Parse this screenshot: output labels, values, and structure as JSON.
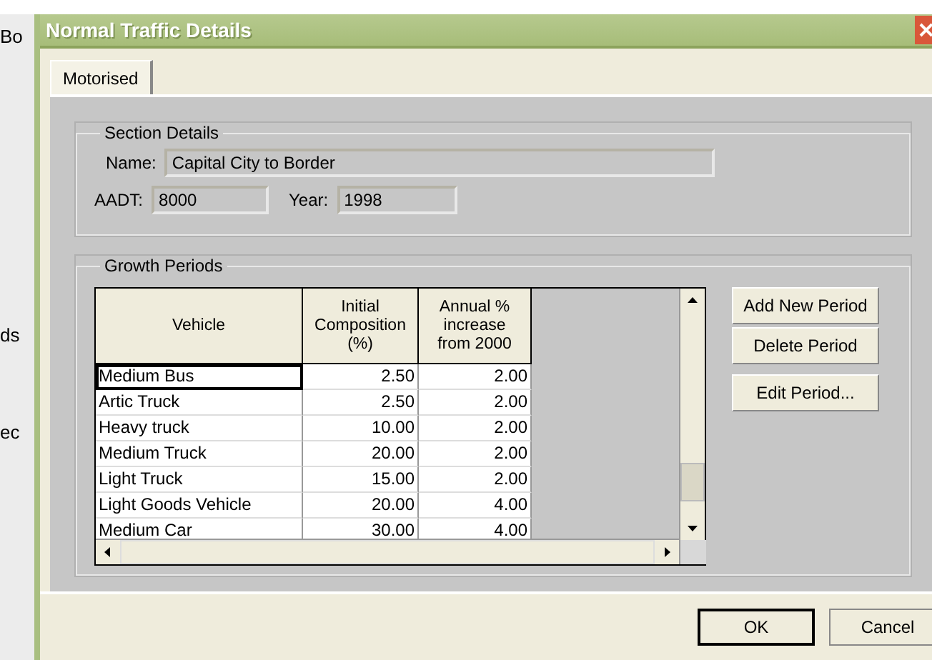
{
  "background_window": {
    "fragments": [
      "Bo",
      "ds",
      "ec"
    ]
  },
  "window": {
    "title": "Normal Traffic Details"
  },
  "tabs": [
    {
      "label": "Motorised",
      "selected": true
    }
  ],
  "section_details": {
    "title": "Section Details",
    "name_label": "Name:",
    "name_value": "Capital City to Border",
    "aadt_label": "AADT:",
    "aadt_value": "8000",
    "year_label": "Year:",
    "year_value": "1998"
  },
  "growth_periods": {
    "title": "Growth Periods",
    "columns": [
      "Vehicle",
      "Initial Composition (%)",
      "Annual % increase from 2000"
    ],
    "rows": [
      {
        "vehicle": "Medium Bus",
        "initial": "2.50",
        "annual": "2.00",
        "selected": true
      },
      {
        "vehicle": "Artic Truck",
        "initial": "2.50",
        "annual": "2.00",
        "selected": false
      },
      {
        "vehicle": "Heavy truck",
        "initial": "10.00",
        "annual": "2.00",
        "selected": false
      },
      {
        "vehicle": "Medium Truck",
        "initial": "20.00",
        "annual": "2.00",
        "selected": false
      },
      {
        "vehicle": "Light Truck",
        "initial": "15.00",
        "annual": "2.00",
        "selected": false
      },
      {
        "vehicle": "Light Goods Vehicle",
        "initial": "20.00",
        "annual": "4.00",
        "selected": false
      },
      {
        "vehicle": "Medium Car",
        "initial": "30.00",
        "annual": "4.00",
        "selected": false
      }
    ],
    "buttons": [
      "Add New Period",
      "Delete Period",
      "Edit Period..."
    ]
  },
  "dialog_buttons": [
    {
      "label": "OK",
      "default": true
    },
    {
      "label": "Cancel",
      "default": false
    }
  ]
}
